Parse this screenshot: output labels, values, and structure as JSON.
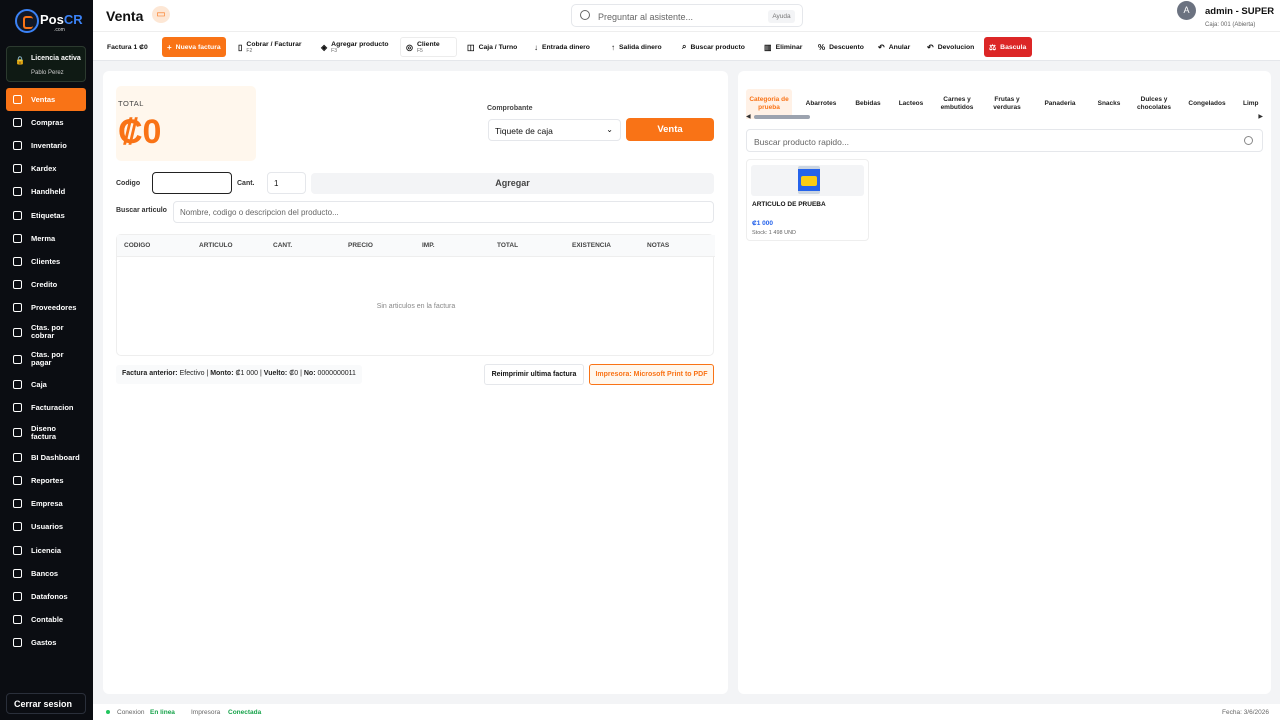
{
  "brand": {
    "name_a": "Pos",
    "name_b": "CR",
    "sub": ".com"
  },
  "license": {
    "title": "Licencia activa",
    "user": "Pablo Perez"
  },
  "sidebar": {
    "items": [
      {
        "label": "Ventas",
        "icon": "cart-icon",
        "glyph": "🛒",
        "active": true
      },
      {
        "label": "Compras",
        "icon": "receipt-icon",
        "glyph": "▤"
      },
      {
        "label": "Inventario",
        "icon": "box-icon",
        "glyph": "◈"
      },
      {
        "label": "Kardex",
        "icon": "chart-icon",
        "glyph": "↗"
      },
      {
        "label": "Handheld",
        "icon": "device-icon",
        "glyph": "▯"
      },
      {
        "label": "Etiquetas",
        "icon": "tag-icon",
        "glyph": "◆"
      },
      {
        "label": "Merma",
        "icon": "trash-icon",
        "glyph": "▥"
      },
      {
        "label": "Clientes",
        "icon": "user-icon",
        "glyph": "◎"
      },
      {
        "label": "Credito",
        "icon": "card-icon",
        "glyph": "▭"
      },
      {
        "label": "Proveedores",
        "icon": "truck-icon",
        "glyph": "▣"
      },
      {
        "label": "Ctas. por cobrar",
        "icon": "download-icon",
        "glyph": "↓",
        "tall": true
      },
      {
        "label": "Ctas. por pagar",
        "icon": "upload-icon",
        "glyph": "↑",
        "tall": true
      },
      {
        "label": "Caja",
        "icon": "cash-icon",
        "glyph": "◫"
      },
      {
        "label": "Facturacion",
        "icon": "document-icon",
        "glyph": "▤"
      },
      {
        "label": "Diseno factura",
        "icon": "pencil-icon",
        "glyph": "✎",
        "tall": true
      },
      {
        "label": "BI Dashboard",
        "icon": "dashboard-icon",
        "glyph": "▦"
      },
      {
        "label": "Reportes",
        "icon": "report-icon",
        "glyph": "▤"
      },
      {
        "label": "Empresa",
        "icon": "building-icon",
        "glyph": "▥"
      },
      {
        "label": "Usuarios",
        "icon": "users-icon",
        "glyph": "◎"
      },
      {
        "label": "Licencia",
        "icon": "lock-icon",
        "glyph": "◘"
      },
      {
        "label": "Bancos",
        "icon": "bank-icon",
        "glyph": "▦"
      },
      {
        "label": "Datafonos",
        "icon": "terminal-icon",
        "glyph": "▭"
      },
      {
        "label": "Contable",
        "icon": "ledger-icon",
        "glyph": "▤"
      },
      {
        "label": "Gastos",
        "icon": "wallet-icon",
        "glyph": "◫"
      }
    ]
  },
  "logout_label": "Cerrar sesion",
  "header": {
    "title": "Venta",
    "ask_placeholder": "Preguntar al asistente...",
    "ask_help": "Ayuda",
    "avatar": "A",
    "user": "admin - SUPER",
    "caja": "Caja: 001 (Abierta)"
  },
  "toolbar": {
    "factura": "Factura 1 ₡0",
    "nueva": "Nueva factura",
    "cobrar": "Cobrar / Facturar",
    "cobrar_key": "F2",
    "agregar": "Agregar producto",
    "agregar_key": "F3",
    "cliente": "Cliente",
    "cliente_key": "F5",
    "caja": "Caja / Turno",
    "entrada": "Entrada dinero",
    "salida": "Salida dinero",
    "buscar": "Buscar producto",
    "eliminar": "Eliminar",
    "descuento": "Descuento",
    "anular": "Anular",
    "devolucion": "Devolucion",
    "bascula": "Bascula"
  },
  "sale": {
    "total_label": "TOTAL",
    "total_value": "₡0",
    "comprobante_label": "Comprobante",
    "comprobante_value": "Tiquete de caja",
    "venta_button": "Venta",
    "codigo_label": "Codigo",
    "cant_label": "Cant.",
    "cant_value": "1",
    "agregar_button": "Agregar",
    "buscar_label": "Buscar articulo",
    "buscar_placeholder": "Nombre, codigo o descripcion del producto...",
    "columns": [
      "CODIGO",
      "ARTICULO",
      "CANT.",
      "PRECIO",
      "IMP.",
      "TOTAL",
      "EXISTENCIA",
      "NOTAS"
    ],
    "empty": "Sin articulos en la factura",
    "prev_label": "Factura anterior:",
    "prev_method": "Efectivo",
    "monto_label": "Monto:",
    "monto_value": "₡1 000",
    "vuelto_label": "Vuelto:",
    "vuelto_value": "₡0",
    "no_label": "No:",
    "no_value": "0000000011",
    "reprint": "Reimprimir ultima factura",
    "printer": "Impresora: Microsoft Print to PDF"
  },
  "catalog": {
    "categories": [
      "Categoria de prueba",
      "Abarrotes",
      "Bebidas",
      "Lacteos",
      "Carnes y embutidos",
      "Frutas y verduras",
      "Panaderia",
      "Snacks",
      "Dulces y chocolates",
      "Congelados",
      "Limp"
    ],
    "search_placeholder": "Buscar producto rapido...",
    "product": {
      "name": "ARTICULO DE PRUEBA",
      "price": "₡1 000",
      "stock": "Stock: 1 498 UND"
    }
  },
  "status": {
    "conexion_label": "Conexion",
    "conexion_value": "En linea",
    "impresora_label": "Impresora",
    "impresora_value": "Conectada",
    "fecha": "Fecha: 3/6/2026"
  },
  "colors": {
    "accent": "#f97316",
    "danger": "#dc2626",
    "sidebar": "#0b0d12",
    "success": "#16a34a",
    "link": "#2563eb"
  }
}
